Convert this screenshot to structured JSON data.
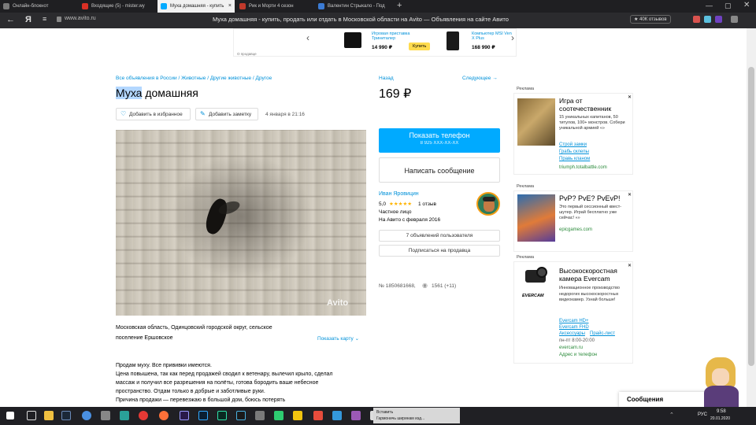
{
  "tabs": [
    {
      "label": "Онлайн-блокнот",
      "color": "#7a7a7a"
    },
    {
      "label": "Входящие (5) - mister.wy",
      "color": "#d93025"
    },
    {
      "label": "Муха домашняя - купить",
      "color": "#00aaff",
      "active": true
    },
    {
      "label": "Рик и Морти 4 сезон",
      "color": "#c0392b"
    },
    {
      "label": "Валентин Стрыкало - Под",
      "color": "#3b7bd4"
    }
  ],
  "tab_add": "+",
  "address": {
    "back": "←",
    "ya": "Я",
    "url": "www.avito.ru",
    "title": "Муха домашняя - купить, продать или отдать в Московской области на Avito — Объявления на сайте Авито",
    "reviews": "★ 40К отзывов"
  },
  "banner": {
    "prev": "‹",
    "next": "›",
    "item1_title": "Игровая приставка Триниталер",
    "item1_price": "14 990 ₽",
    "item1_btn": "Купить",
    "item2_title": "Компьютер MSI Ven X Plus",
    "item2_price": "168 990 ₽",
    "footer": "О продавце"
  },
  "breadcrumbs": "Все объявления в России / Животные / Другие животные / Другое",
  "nav_back": "Назад",
  "nav_next": "Следующее →",
  "title_highlight": "Муха",
  "title_rest": " домашняя",
  "price": "169 ₽",
  "fav_btn": "Добавить в избранное",
  "note_btn": "Добавить заметку",
  "date": "4 января в 21:16",
  "photo_watermark": "Avito",
  "phone_btn": "Показать телефон",
  "phone_mask": "8 925 XXX-XX-XX",
  "message_btn": "Написать сообщение",
  "seller": {
    "name": "Иван Яровицин",
    "rating": "5,0",
    "stars": "★★★★★",
    "reviews": "1 отзыв",
    "type": "Частное лицо",
    "since": "На Авито с февраля 2016",
    "ads_btn": "7 объявлений пользователя",
    "subscribe_btn": "Подписаться на продавца"
  },
  "ad_number": "№ 1850681668,",
  "views": "1561 (+11)",
  "location_line1": "Московская область, Одинцовский городской округ, сельское",
  "location_line2": "поселение Ершовское",
  "show_map": "Показать карту ⌄",
  "description": [
    "Продам муху. Все прививки имеются.",
    "Цена повышена, так как перед продажей сводил к ветенару, вылечил крыло, сделал",
    "массаж и получил все разрешения на полёты, готова бородить ваше небесное",
    "пространство. Отдам только в добрые и заботливые руки.",
    "Причина продажи — перевезжаю в большой дом, боюсь потерять"
  ],
  "ads": [
    {
      "label": "Реклама",
      "title": "Игра от соотечественник",
      "text": "15 уникальных капитанов, 50 титулов, 100+ монстров. Собери уникальной армией «»",
      "links": [
        "Строй замки",
        "Грабь склепы",
        "Правь кланом"
      ],
      "domain": "triumph.totalbattle.com"
    },
    {
      "label": "Реклама",
      "title": "PvP? PvE? PvEvP!",
      "text": "Это первый сессионный квест-шутер. Играй бесплатно уже сейчас! «»",
      "domain": "epicgames.com"
    },
    {
      "label": "Реклама",
      "title": "Высокоскоростная камера Evercam",
      "text": "Инновационное производство недорогих высокоскоростных видеокамер. Узнай больше!",
      "links": [
        "Evercam HD+",
        "Evercam FHD",
        "Аксессуары",
        "Прайс-лист"
      ],
      "hours": "пн-пт 8:00-20:00",
      "domain": "evercam.ru",
      "contacts": "Адрес и телефон"
    }
  ],
  "messages_label": "Сообщения",
  "taskbar": {
    "item1": "Вставить",
    "item2": "Гармоничь ширинам изд...",
    "lang": "РУС",
    "time": "9:58",
    "date": "20.01.2020"
  },
  "colors": {
    "accent": "#00aaff",
    "link": "#0091d9",
    "highlight": "#b3d7ff"
  }
}
